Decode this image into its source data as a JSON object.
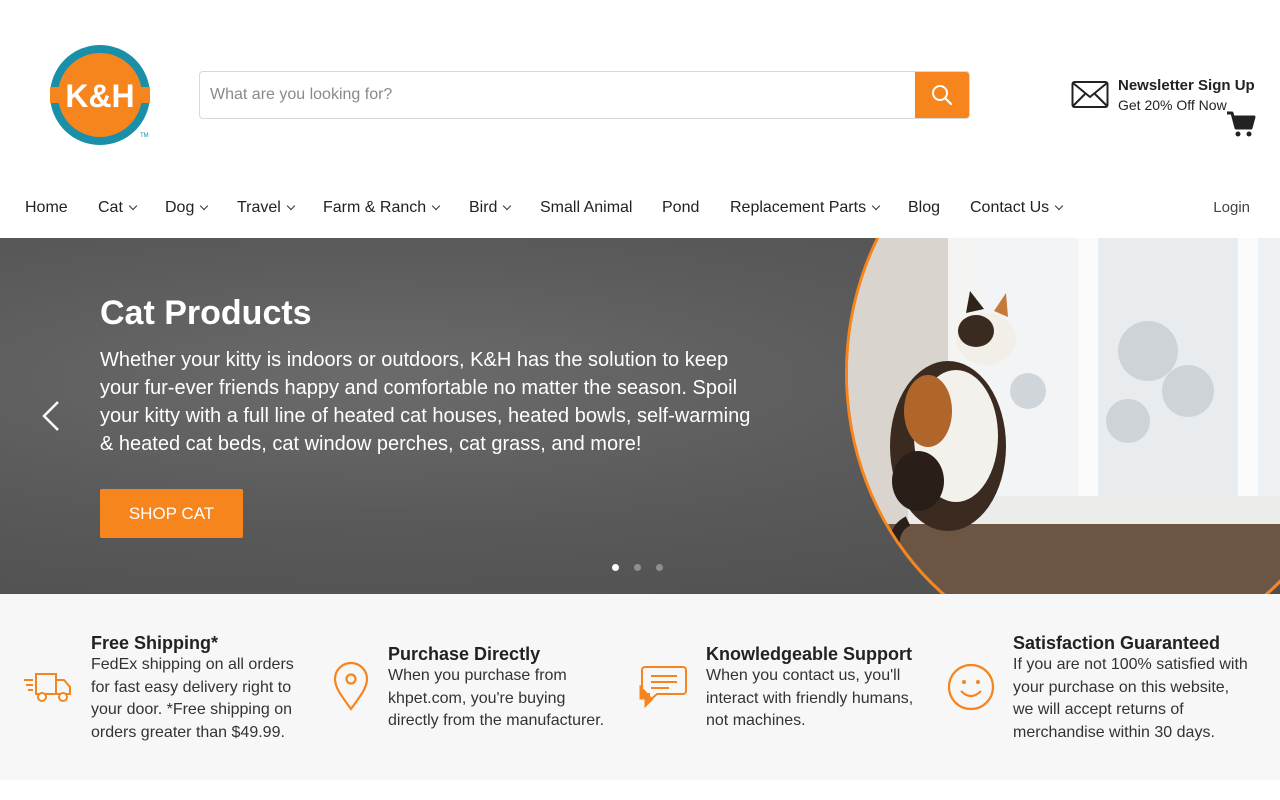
{
  "brand": {
    "logo_text": "K&H",
    "accent": "#f7851e",
    "teal": "#1a8fa8"
  },
  "search": {
    "placeholder": "What are you looking for?",
    "button_icon": "search-icon"
  },
  "newsletter": {
    "title": "Newsletter Sign Up",
    "subtitle": "Get 20% Off Now",
    "icon": "envelope-icon"
  },
  "cart": {
    "icon": "cart-icon"
  },
  "nav": {
    "items": [
      {
        "label": "Home",
        "dropdown": false
      },
      {
        "label": "Cat",
        "dropdown": true
      },
      {
        "label": "Dog",
        "dropdown": true
      },
      {
        "label": "Travel",
        "dropdown": true
      },
      {
        "label": "Farm & Ranch",
        "dropdown": true
      },
      {
        "label": "Bird",
        "dropdown": true
      },
      {
        "label": "Small Animal",
        "dropdown": false
      },
      {
        "label": "Pond",
        "dropdown": false
      },
      {
        "label": "Replacement Parts",
        "dropdown": true
      },
      {
        "label": "Blog",
        "dropdown": false
      },
      {
        "label": "Contact Us",
        "dropdown": true
      }
    ],
    "login": "Login"
  },
  "hero": {
    "title": "Cat Products",
    "text": "Whether your kitty is indoors or outdoors, K&H has the solution to keep your fur-ever friends happy and comfortable no matter the season. Spoil your kitty with a full line of heated cat houses, heated bowls, self-warming & heated cat beds, cat window perches, cat grass, and more!",
    "button": "SHOP CAT",
    "slide_count": 3,
    "active_slide": 1
  },
  "features": [
    {
      "icon": "truck-icon",
      "title": "Free Shipping*",
      "text": "FedEx shipping on all orders for fast easy delivery right to your door. *Free shipping on orders greater than $49.99."
    },
    {
      "icon": "map-pin-icon",
      "title": "Purchase Directly",
      "text": "When you purchase from khpet.com, you're buying directly from the manufacturer."
    },
    {
      "icon": "chat-icon",
      "title": "Knowledgeable Support",
      "text": "When you contact us, you'll interact with friendly humans, not machines."
    },
    {
      "icon": "smiley-icon",
      "title": "Satisfaction Guaranteed",
      "text": "If you are not 100% satisfied with your purchase on this website, we will accept returns of merchandise within 30 days."
    }
  ]
}
